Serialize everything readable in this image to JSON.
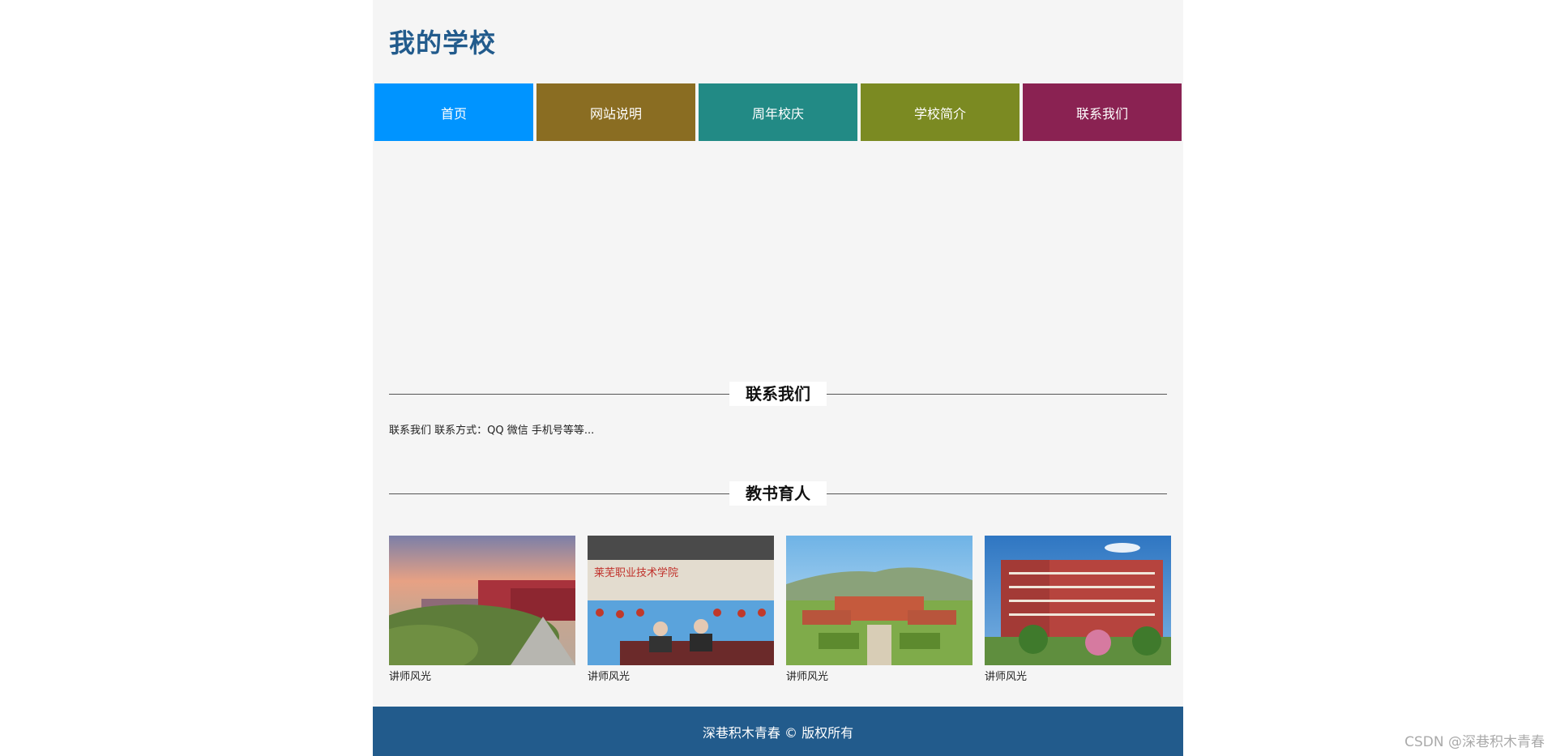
{
  "header": {
    "title": "我的学校"
  },
  "nav": {
    "items": [
      {
        "label": "首页",
        "color": "#0094ff"
      },
      {
        "label": "网站说明",
        "color": "#8a6d22"
      },
      {
        "label": "周年校庆",
        "color": "#228a85"
      },
      {
        "label": "学校简介",
        "color": "#7b8a22"
      },
      {
        "label": "联系我们",
        "color": "#8a2252"
      }
    ]
  },
  "contact": {
    "heading": "联系我们",
    "text": "联系我们 联系方式：QQ 微信 手机号等等..."
  },
  "teaching": {
    "heading": "教书育人",
    "gallery": [
      {
        "caption": "讲师风光",
        "image": "campus-sunset-photo"
      },
      {
        "caption": "讲师风光",
        "image": "lecture-hall-photo"
      },
      {
        "caption": "讲师风光",
        "image": "campus-aerial-photo"
      },
      {
        "caption": "讲师风光",
        "image": "red-building-photo"
      }
    ]
  },
  "footer": {
    "text": "深巷积木青春 © 版权所有"
  },
  "watermark": {
    "text": "CSDN @深巷积木青春"
  },
  "colors": {
    "brand": "#225b8c",
    "page_bg": "#f5f5f5"
  }
}
